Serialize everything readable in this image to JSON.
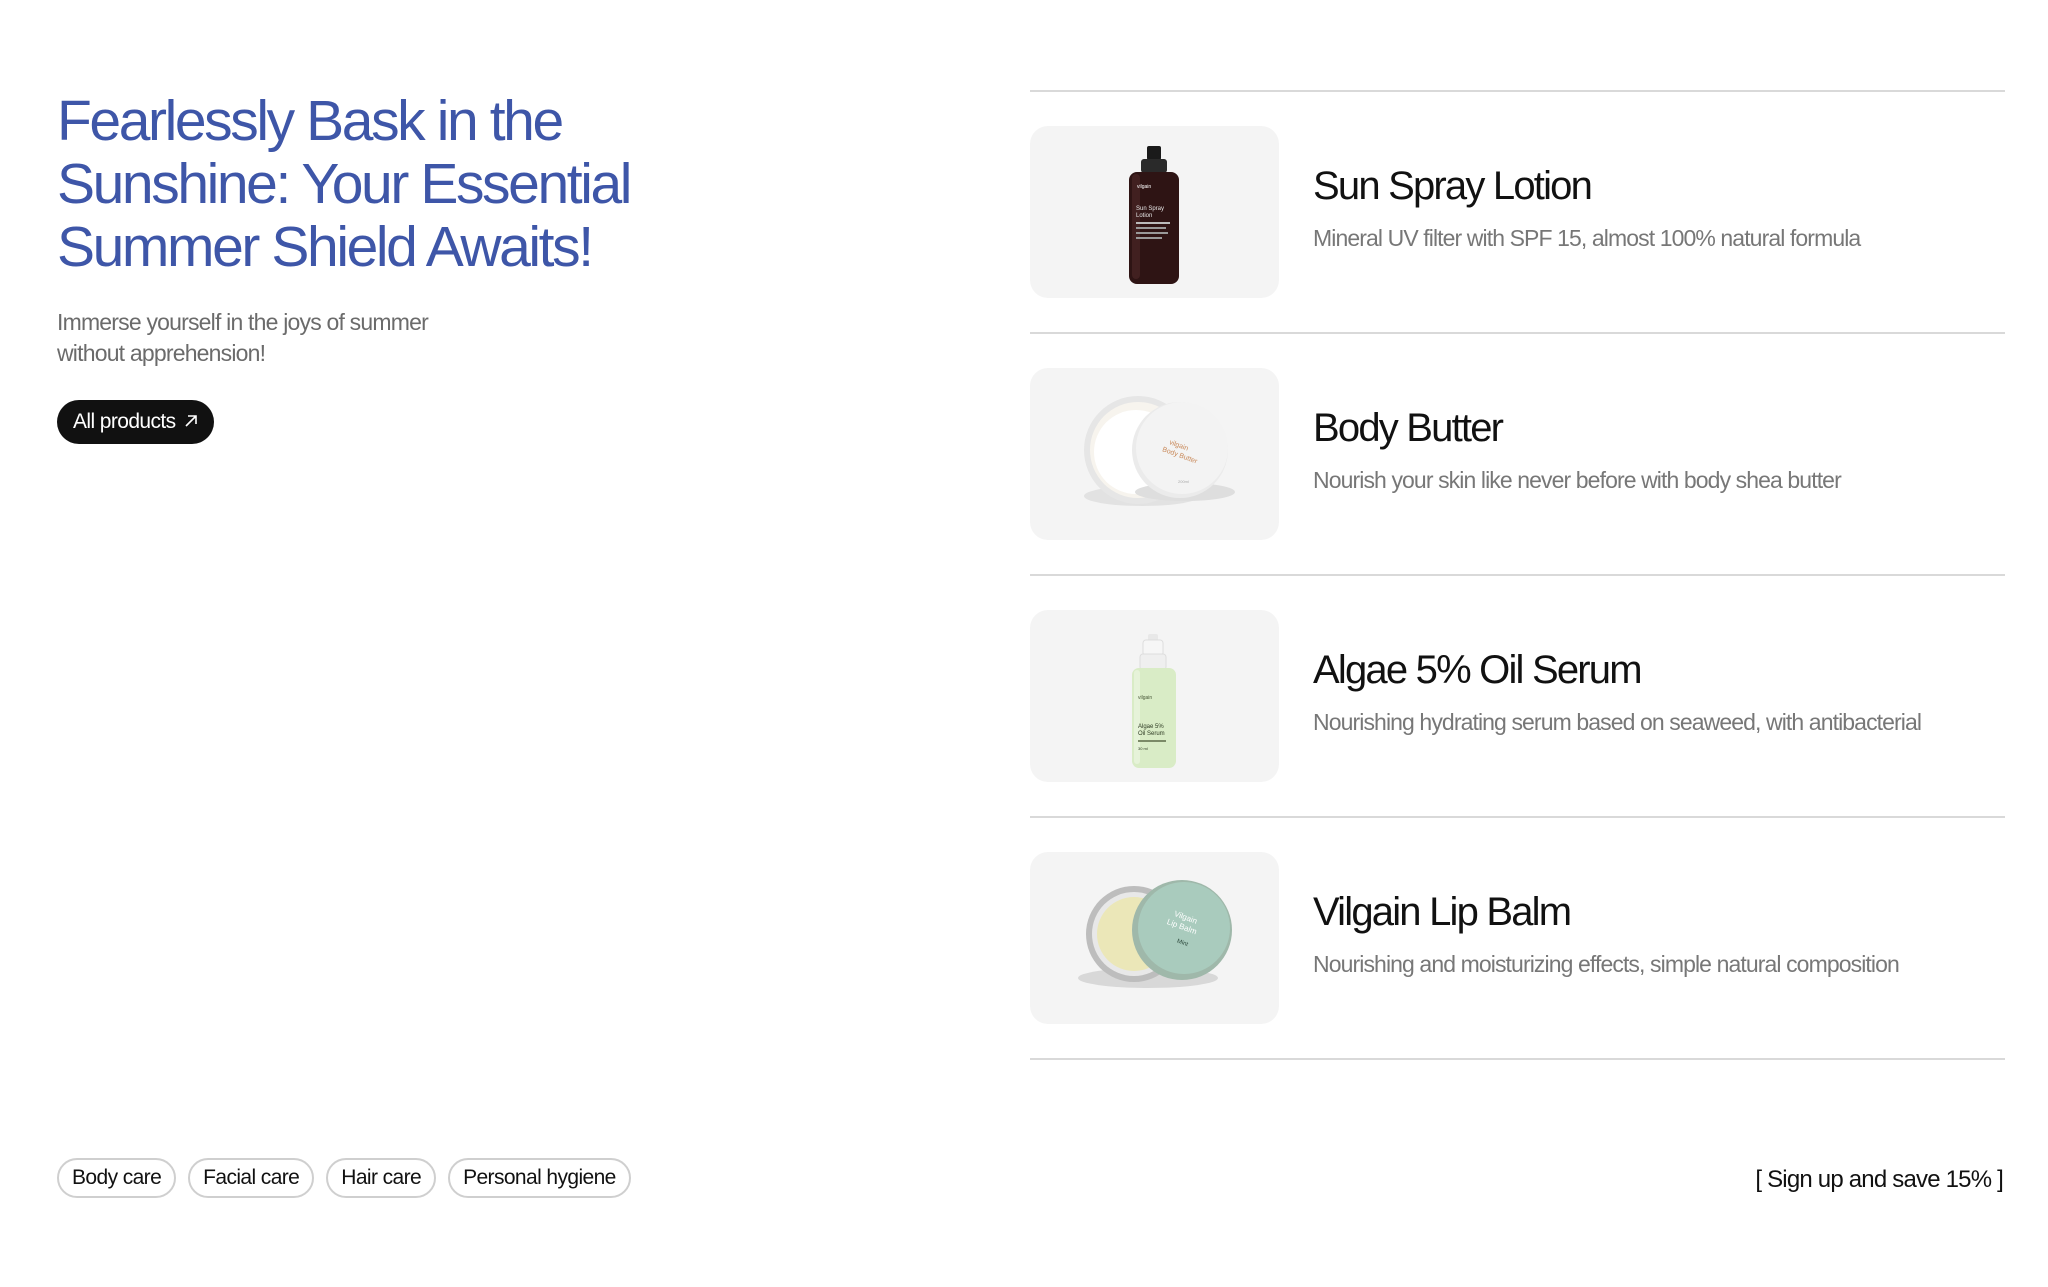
{
  "hero": {
    "title": "Fearlessly Bask in the Sunshine: Your Essential Summer Shield Awaits!",
    "subtitle": "Immerse yourself in the joys of summer without apprehension!",
    "cta_label": "All products",
    "cta_icon": "arrow-up-right-icon"
  },
  "products": [
    {
      "name": "Sun Spray Lotion",
      "description": "Mineral UV filter with SPF 15, almost 100% natural formula",
      "image_icon": "spray-bottle-icon",
      "label_text": "Sun Spray Lotion",
      "brand": "vilgain"
    },
    {
      "name": "Body Butter",
      "description": "Nourish your skin like never before with body shea butter",
      "image_icon": "butter-jar-icon",
      "label_text": "Body Butter",
      "brand": "vilgain"
    },
    {
      "name": "Algae 5% Oil Serum",
      "description": "Nourishing hydrating serum based on seaweed, with antibacterial",
      "image_icon": "serum-bottle-icon",
      "label_text": "Algae 5% Oil Serum",
      "brand": "vilgain"
    },
    {
      "name": "Vilgain Lip Balm",
      "description": "Nourishing and moisturizing effects, simple natural composition",
      "image_icon": "lip-balm-tin-icon",
      "label_text": "Vilgain Lip Balm",
      "brand": "Vilgain"
    }
  ],
  "categories": [
    "Body care",
    "Facial care",
    "Hair care",
    "Personal hygiene"
  ],
  "signup_text": "[ Sign up and save 15% ]",
  "colors": {
    "accent": "#3e56a8",
    "button_bg": "#111111",
    "thumb_bg": "#f4f4f4",
    "divider": "#d9d9d9",
    "muted_text": "#777777"
  }
}
